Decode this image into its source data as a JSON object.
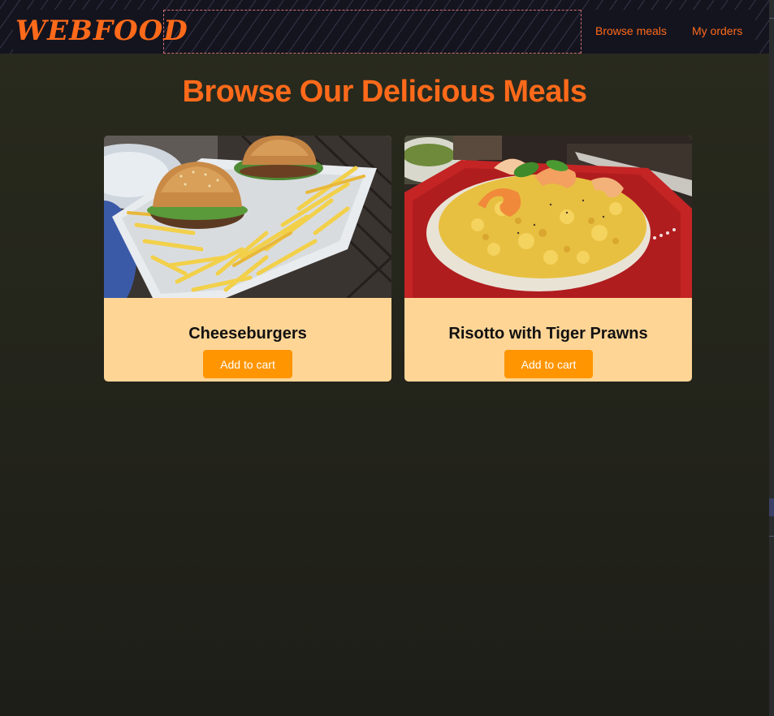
{
  "header": {
    "logo": "WEBFOOD",
    "nav": [
      {
        "label": "Browse meals"
      },
      {
        "label": "My orders"
      }
    ]
  },
  "page": {
    "title": "Browse Our Delicious Meals"
  },
  "meals": [
    {
      "name": "Cheeseburgers",
      "button_label": "Add to cart",
      "image": "cheeseburgers-with-fries-photo"
    },
    {
      "name": "Risotto with Tiger Prawns",
      "button_label": "Add to cart",
      "image": "risotto-with-prawns-photo"
    }
  ],
  "colors": {
    "accent": "#ff6a1a",
    "button": "#ff9500",
    "card": "#ffd596",
    "background": "#24251b"
  }
}
